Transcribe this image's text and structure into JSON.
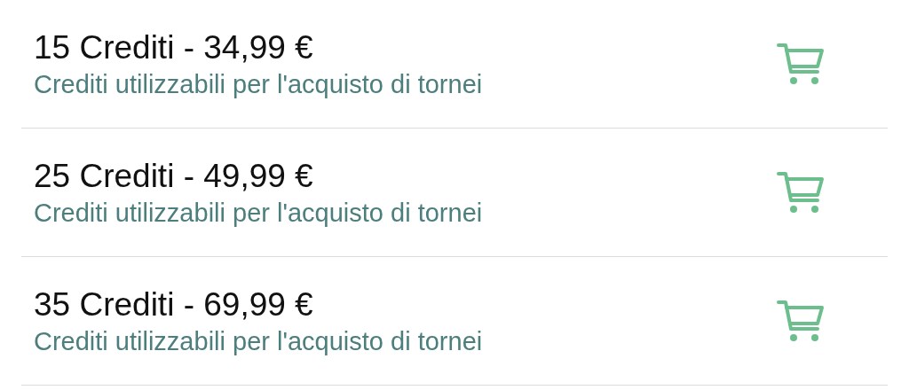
{
  "products": [
    {
      "title": "15 Crediti - 34,99 €",
      "subtitle": "Crediti utilizzabili per l'acquisto di tornei"
    },
    {
      "title": "25 Crediti - 49,99 €",
      "subtitle": "Crediti utilizzabili per l'acquisto di tornei"
    },
    {
      "title": "35 Crediti - 69,99 €",
      "subtitle": "Crediti utilizzabili per l'acquisto di tornei"
    }
  ]
}
